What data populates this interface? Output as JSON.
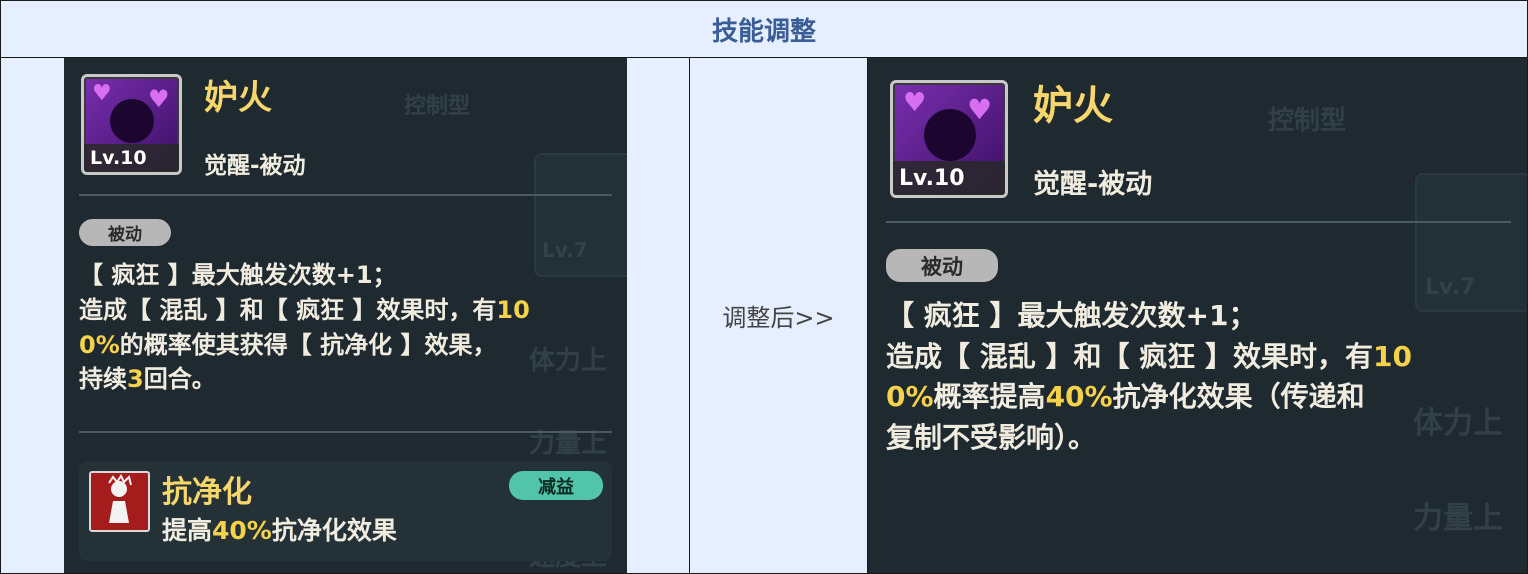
{
  "header": {
    "title": "技能调整"
  },
  "middle": {
    "label": "调整后>>"
  },
  "left_card": {
    "name": "妒火",
    "level": "Lv.10",
    "type": "觉醒-被动",
    "tag": "被动",
    "desc_line1": "【 疯狂 】最大触发次数+1；",
    "desc_line2_a": "造成【 混乱 】和【 疯狂 】效果时，有",
    "desc_line2_hl": "10",
    "desc_line3_hl": "0%",
    "desc_line3_b": "的概率使其获得【 抗净化 】效果，",
    "desc_line4_a": "持续",
    "desc_line4_hl": "3",
    "desc_line4_b": "回合。",
    "buff": {
      "name": "抗净化",
      "badge": "减益",
      "desc_a": "提高",
      "desc_hl": "40%",
      "desc_b": "抗净化效果"
    },
    "bg_texts": [
      "控制型",
      "Lv.7",
      "体力上",
      "力量上",
      "速度上"
    ]
  },
  "right_card": {
    "name": "妒火",
    "level": "Lv.10",
    "type": "觉醒-被动",
    "tag": "被动",
    "desc_line1": "【 疯狂 】最大触发次数+1；",
    "desc_line2_a": "造成【 混乱 】和【 疯狂 】效果时，有",
    "desc_line2_hl": "10",
    "desc_line3_hl": "0%",
    "desc_line3_b": "概率提高",
    "desc_line3_hl2": "40%",
    "desc_line3_c": "抗净化效果（传递和",
    "desc_line4": "复制不受影响）。",
    "bg_texts": [
      "控制型",
      "Lv.7",
      "体力上",
      "力量上"
    ]
  }
}
